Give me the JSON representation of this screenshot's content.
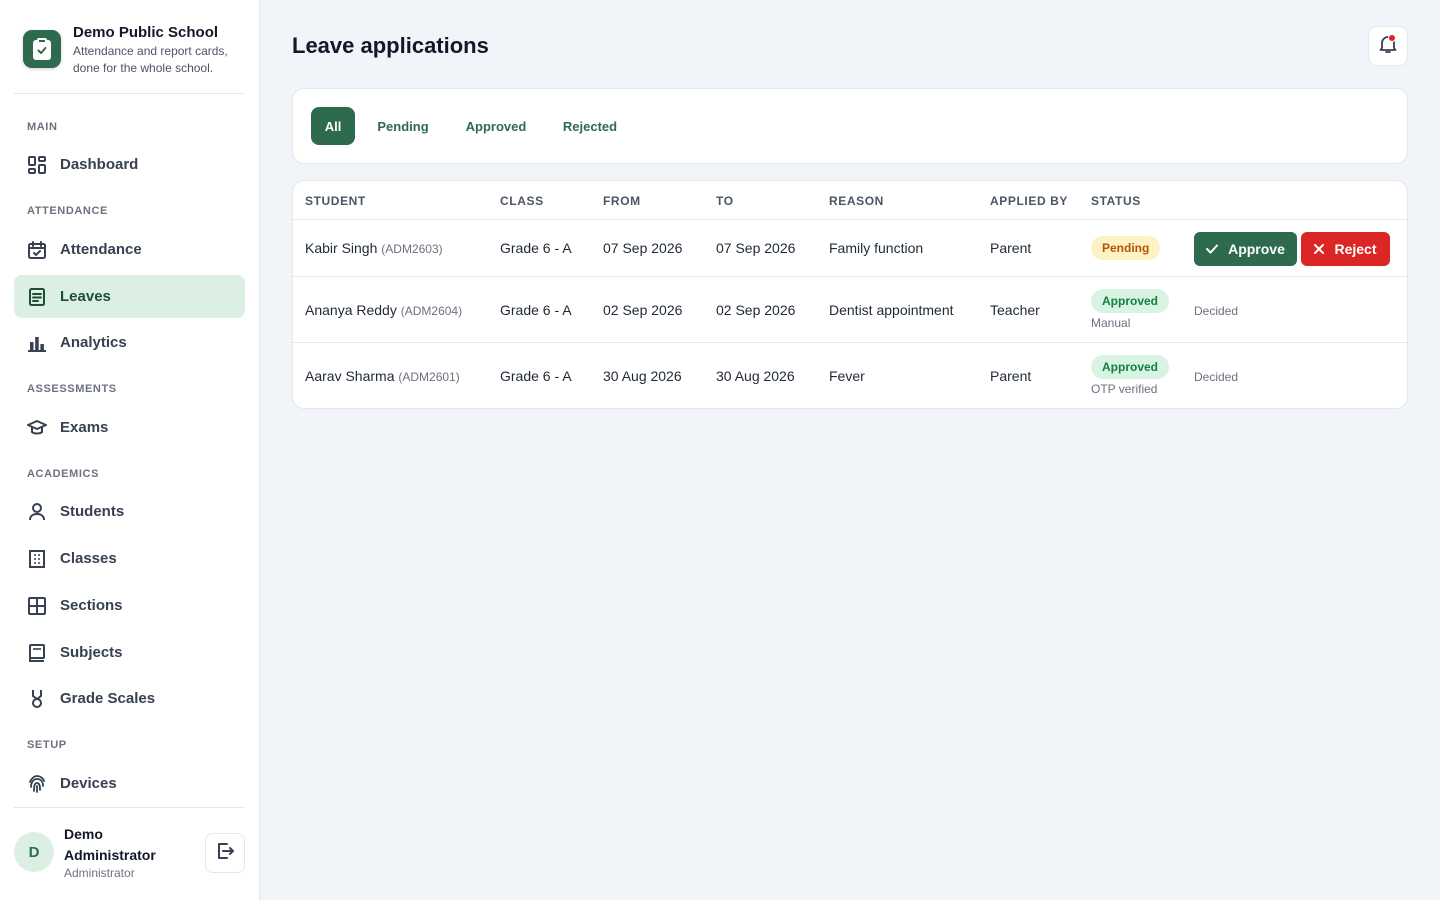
{
  "brand": {
    "name": "Demo Public School",
    "tagline": "Attendance and report cards, done for the whole school."
  },
  "sidebar": {
    "sections": [
      "MAIN",
      "ATTENDANCE",
      "ASSESSMENTS",
      "ACADEMICS",
      "SETUP"
    ],
    "items": [
      {
        "label": "Dashboard",
        "icon": "dashboard-icon"
      },
      {
        "label": "Attendance",
        "icon": "calendar-check-icon"
      },
      {
        "label": "Leaves",
        "icon": "document-icon",
        "active": true
      },
      {
        "label": "Analytics",
        "icon": "bar-chart-icon"
      },
      {
        "label": "Exams",
        "icon": "graduation-cap-icon"
      },
      {
        "label": "Students",
        "icon": "user-icon"
      },
      {
        "label": "Classes",
        "icon": "building-icon"
      },
      {
        "label": "Sections",
        "icon": "grid-icon"
      },
      {
        "label": "Subjects",
        "icon": "book-icon"
      },
      {
        "label": "Grade Scales",
        "icon": "medal-icon"
      },
      {
        "label": "Devices",
        "icon": "fingerprint-icon"
      }
    ]
  },
  "user": {
    "initial": "D",
    "name": "Demo Administrator",
    "role": "Administrator"
  },
  "page": {
    "title": "Leave applications"
  },
  "filters": {
    "tabs": [
      "All",
      "Pending",
      "Approved",
      "Rejected"
    ],
    "active": "All"
  },
  "table": {
    "headers": [
      "STUDENT",
      "CLASS",
      "FROM",
      "TO",
      "REASON",
      "APPLIED BY",
      "STATUS"
    ],
    "rows": [
      {
        "student": "Kabir Singh",
        "adm": "(ADM2603)",
        "class": "Grade 6 - A",
        "from": "07 Sep 2026",
        "to": "07 Sep 2026",
        "reason": "Family function",
        "applied_by": "Parent",
        "status": "Pending",
        "status_note": "",
        "approve_label": "Approve",
        "reject_label": "Reject"
      },
      {
        "student": "Ananya Reddy",
        "adm": "(ADM2604)",
        "class": "Grade 6 - A",
        "from": "02 Sep 2026",
        "to": "02 Sep 2026",
        "reason": "Dentist appointment",
        "applied_by": "Teacher",
        "status": "Approved",
        "status_note": "Manual",
        "action_text": "Decided"
      },
      {
        "student": "Aarav Sharma",
        "adm": "(ADM2601)",
        "class": "Grade 6 - A",
        "from": "30 Aug 2026",
        "to": "30 Aug 2026",
        "reason": "Fever",
        "applied_by": "Parent",
        "status": "Approved",
        "status_note": "OTP verified",
        "action_text": "Decided"
      }
    ]
  },
  "colors": {
    "primary": "#2e6b4e",
    "active_bg": "#dcefe3",
    "danger": "#dc2626",
    "pending_bg": "#fdf2c4",
    "approved_bg": "#d8f3e3"
  }
}
